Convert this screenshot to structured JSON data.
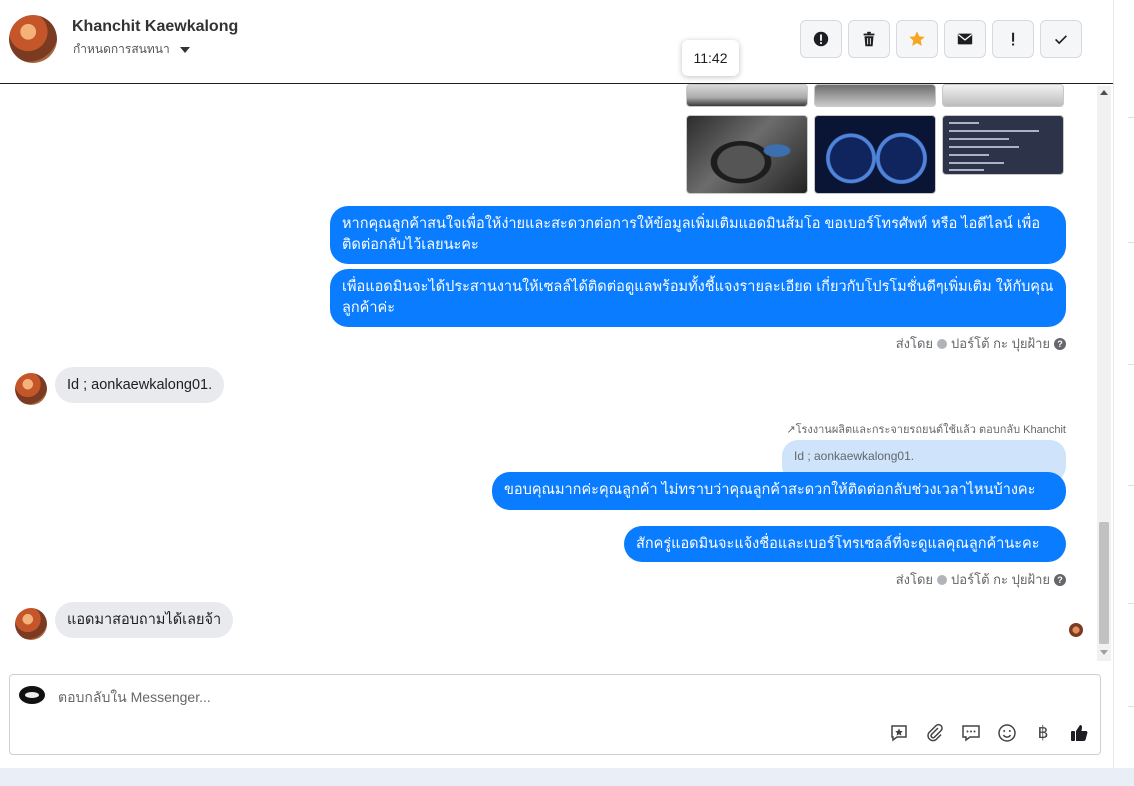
{
  "header": {
    "contact_name": "Khanchit Kaewkalong",
    "assign_label": "กำหนดการสนทนา",
    "timestamp_tooltip": "11:42"
  },
  "toolbar": {
    "icons": [
      "alert-circle-icon",
      "trash-icon",
      "star-icon",
      "mail-icon",
      "exclamation-icon",
      "check-icon"
    ],
    "star_color": "#f5a623"
  },
  "messages": {
    "out1": "หากคุณลูกค้าสนใจเพื่อให้ง่ายและสะดวกต่อการให้ข้อมูลเพิ่มเติมแอดมินส้มโอ ขอเบอร์โทรศัพท์ หรือ ไอดีไลน์ เพื่อติดต่อกลับไว้เลยนะคะ",
    "out2": "เพื่อแอดมินจะได้ประสานงานให้เซลล์ได้ติดต่อดูแลพร้อมทั้งชี้แจงรายละเอียด เกี่ยวกับโปรโมชั่นดีๆเพิ่มเติม ให้กับคุณลูกค้าค่ะ",
    "sent_by_1": "ส่งโดย",
    "sender_1": "ปอร์โต้ กะ ปุยฝ้าย",
    "in1": "Id ; aonkaewkalong01.",
    "reply_meta": "โรงงานผลิตและกระจายรถยนต์ใช้แล้ว ตอบกลับ Khanchit",
    "quoted": "Id ; aonkaewkalong01.",
    "out3": "ขอบคุณมากค่ะคุณลูกค้า ไม่ทราบว่าคุณลูกค้าสะดวกให้ติดต่อกลับช่วงเวลาไหนบ้างคะ",
    "out4": "สักครู่แอดมินจะแจ้งชื่อและเบอร์โทรเซลล์ที่จะดูแลคุณลูกค้านะคะ",
    "sent_by_2": "ส่งโดย",
    "sender_2": "ปอร์โต้ กะ ปุยฝ้าย",
    "in2": "แอดมาสอบถามได้เลยจ้า"
  },
  "colors": {
    "outgoing_bubble": "#0a7cff",
    "incoming_bubble": "#e9eaed",
    "quoted_bubble": "#cfe3fb"
  },
  "composer": {
    "placeholder": "ตอบกลับใน Messenger...",
    "tools": [
      "saved-reply-icon",
      "attachment-icon",
      "chat-bubbles-icon",
      "emoji-icon",
      "baht-icon",
      "thumbs-up-icon"
    ],
    "baht_symbol": "฿"
  }
}
